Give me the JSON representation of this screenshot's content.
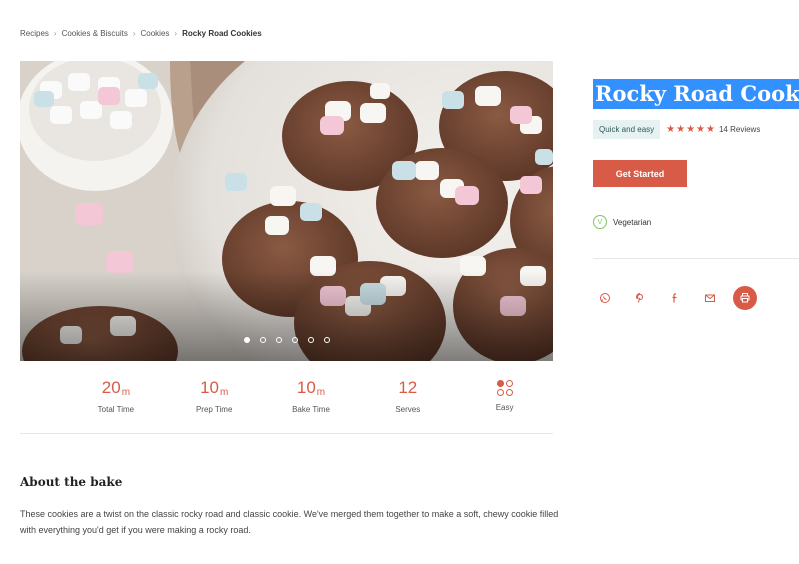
{
  "breadcrumb": {
    "items": [
      "Recipes",
      "Cookies & Biscuits",
      "Cookies",
      "Rocky Road Cookies"
    ],
    "separator": "›"
  },
  "hero": {
    "image_alt": "",
    "carousel_dots": 6,
    "active_dot": 0
  },
  "stats": [
    {
      "value": "20",
      "unit": "m",
      "label": "Total Time"
    },
    {
      "value": "10",
      "unit": "m",
      "label": "Prep Time"
    },
    {
      "value": "10",
      "unit": "m",
      "label": "Bake Time"
    },
    {
      "value": "12",
      "unit": "",
      "label": "Serves"
    },
    {
      "value": "",
      "unit": "",
      "label": "Easy",
      "icon": "difficulty-icon"
    }
  ],
  "about": {
    "title": "About the bake",
    "text": "These cookies are a twist on the classic rocky road and classic cookie. We've merged them together to make a soft, chewy cookie filled with everything you'd get if you were making a rocky road."
  },
  "recipe": {
    "title": "Rocky Road Cookies",
    "tag": "Quick and easy",
    "rating": 5,
    "reviews": "14 Reviews",
    "cta": "Get Started",
    "diet_badge": "V",
    "diet_label": "Vegetarian"
  },
  "share": {
    "icons": [
      "whatsapp-icon",
      "pinterest-icon",
      "facebook-icon",
      "email-icon",
      "print-icon"
    ]
  },
  "colors": {
    "accent": "#d85b47",
    "tag_bg": "#e6f1f1",
    "selection": "#3390ff",
    "veg_green": "#7fc464"
  }
}
